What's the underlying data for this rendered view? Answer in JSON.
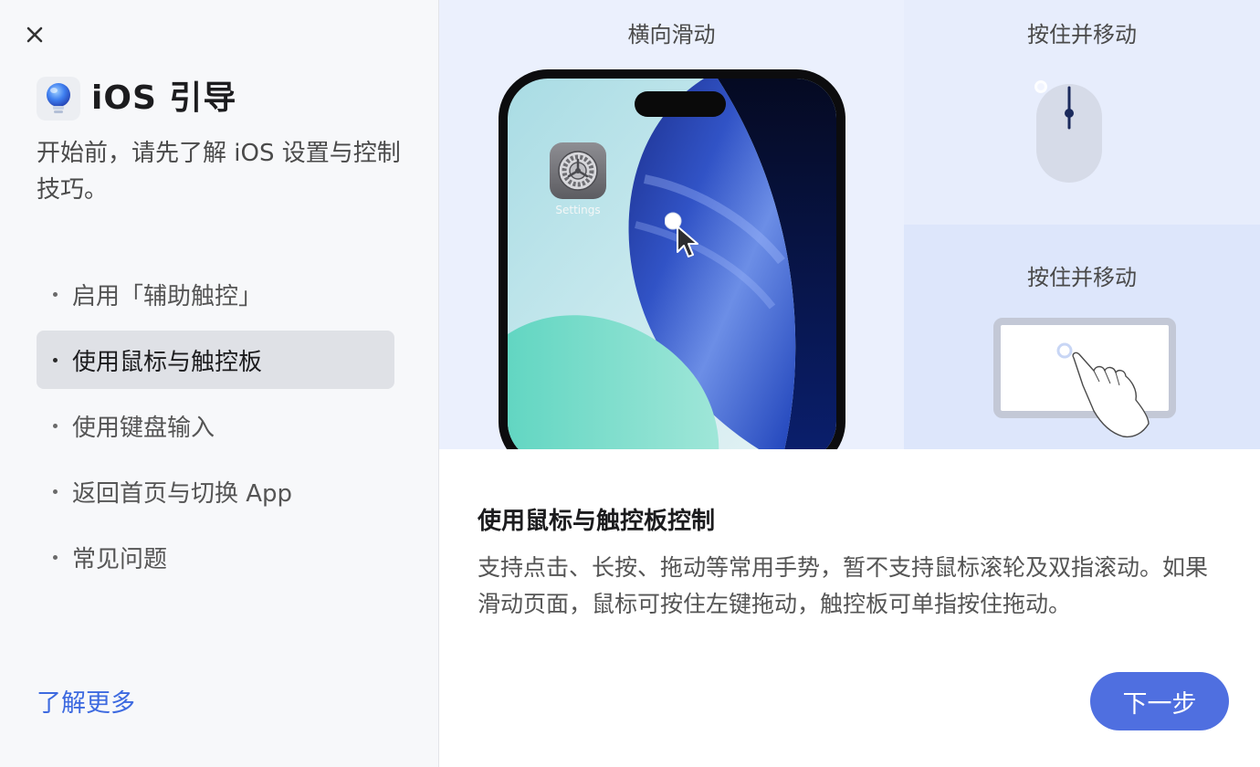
{
  "window": {
    "close_icon": "close-icon",
    "app_icon": "lightbulb-icon"
  },
  "sidebar": {
    "title": "iOS 引导",
    "subtitle": "开始前，请先了解 iOS 设置与控制技巧。",
    "items": [
      {
        "label": "启用「辅助触控」",
        "active": false
      },
      {
        "label": "使用鼠标与触控板",
        "active": true
      },
      {
        "label": "使用键盘输入",
        "active": false
      },
      {
        "label": "返回首页与切换 App",
        "active": false
      },
      {
        "label": "常见问题",
        "active": false
      }
    ],
    "learn_more": "了解更多"
  },
  "illustration": {
    "main_label": "横向滑动",
    "settings_app_label": "Settings",
    "mouse_label": "按住并移动",
    "trackpad_label": "按住并移动"
  },
  "content": {
    "title": "使用鼠标与触控板控制",
    "description": "支持点击、长按、拖动等常用手势，暂不支持鼠标滚轮及双指滚动。如果滑动页面，鼠标可按住左键拖动，触控板可单指按住拖动。",
    "next_button": "下一步"
  },
  "colors": {
    "accent": "#4f6fe0",
    "link": "#3d6ae0",
    "active_item_bg": "#dfe1e6"
  }
}
